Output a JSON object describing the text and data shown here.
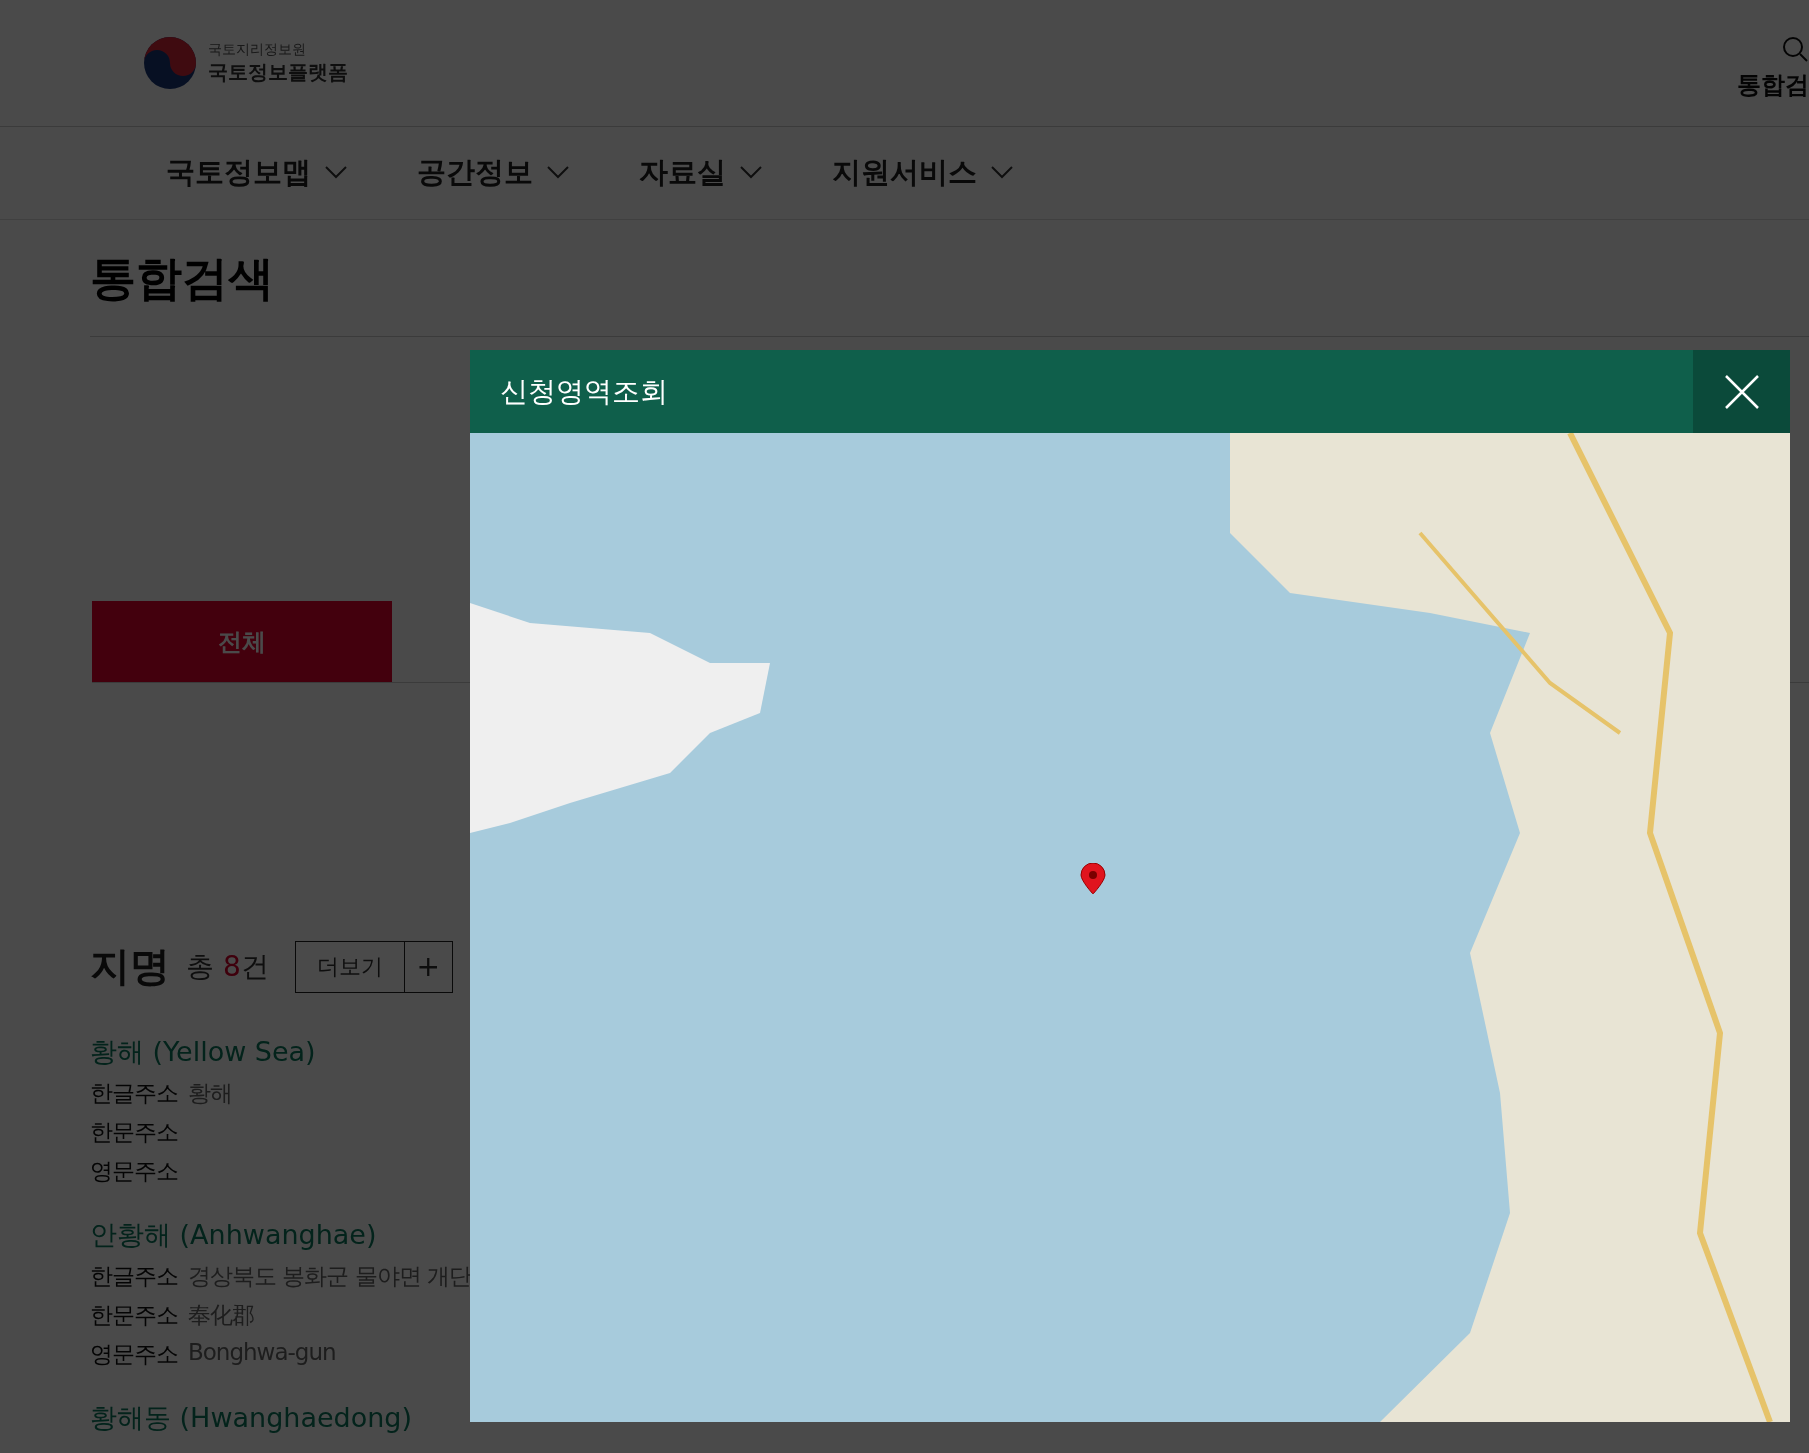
{
  "header": {
    "org_name": "국토지리정보원",
    "site_name": "국토정보플랫폼",
    "search_label": "통합검"
  },
  "nav": [
    {
      "label": "국토정보맵"
    },
    {
      "label": "공간정보"
    },
    {
      "label": "자료실"
    },
    {
      "label": "지원서비스"
    }
  ],
  "page_title": "통합검색",
  "tabs": [
    {
      "label": "전체",
      "selected": true
    }
  ],
  "section": {
    "title": "지명",
    "total_prefix": "총",
    "count": "8",
    "total_suffix": "건",
    "more_button": "더보기",
    "plus_button": "+"
  },
  "places": [
    {
      "name": "황해 (Yellow Sea)",
      "fields": [
        {
          "label": "한글주소",
          "value": "황해"
        },
        {
          "label": "한문주소"
        },
        {
          "label": "영문주소"
        }
      ]
    },
    {
      "name": "안황해 (Anhwanghae)",
      "fields": [
        {
          "label": "한글주소",
          "value": "경상북도 봉화군 물야면 개단"
        },
        {
          "label": "한문주소",
          "value": "奉化郡"
        },
        {
          "label": "영문주소",
          "value": "Bonghwa-gun"
        }
      ]
    },
    {
      "name": "황해동 (Hwanghaedong)"
    }
  ],
  "modal": {
    "title": "신청영역조회"
  }
}
